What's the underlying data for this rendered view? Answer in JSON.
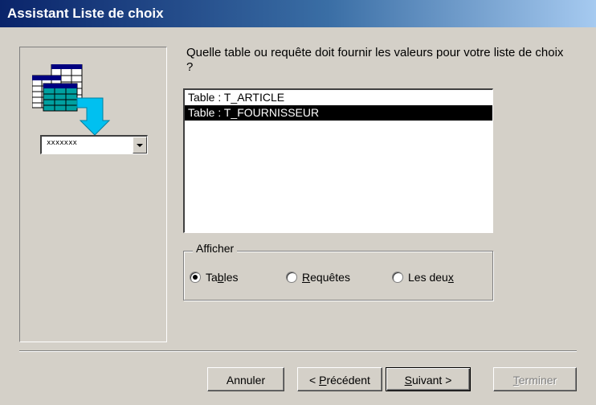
{
  "window": {
    "title": "Assistant Liste de choix"
  },
  "prompt": "Quelle table ou requête doit fournir les valeurs pour votre liste de choix ?",
  "list": {
    "items": [
      "Table : T_ARTICLE",
      "Table : T_FOURNISSEUR"
    ],
    "selected_index": 1
  },
  "display_group": {
    "legend": "Afficher",
    "options": [
      {
        "label": "Tables",
        "accel_index": 2,
        "checked": true
      },
      {
        "label": "Requêtes",
        "accel_index": 0,
        "checked": false
      },
      {
        "label": "Les deux",
        "accel_index": 7,
        "checked": false
      }
    ]
  },
  "illustration": {
    "combo_text": "xxxxxxx",
    "icon": "table-to-combo-icon"
  },
  "buttons": {
    "cancel": "Annuler",
    "previous": "< Précédent",
    "next": "Suivant >",
    "finish": "Terminer"
  },
  "colors": {
    "titlebar_start": "#0a246a",
    "titlebar_end": "#a6caf0",
    "dialog_bg": "#d4d0c8",
    "selection_bg": "#000000",
    "arrow": "#00c0f0"
  }
}
